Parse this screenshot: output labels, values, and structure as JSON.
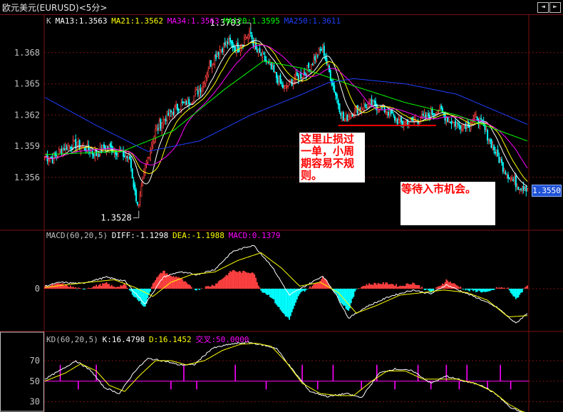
{
  "window": {
    "title": "欧元美元(EURUSD)<5分>",
    "nav_prev_icon": "arrow-left-icon",
    "nav_next_icon": "arrow-right-icon"
  },
  "colors": {
    "grid": "#7a1010",
    "up": "#ff4040",
    "down": "#00ffff",
    "ma13": "#ffffff",
    "ma21": "#ffff00",
    "ma34": "#ff00ff",
    "ma120": "#00ff00",
    "ma250": "#1f3fff",
    "note_text": "#ff0000",
    "support_line": "#ff0000"
  },
  "main_panel": {
    "legend": [
      {
        "key": "k",
        "text": "K",
        "color": "#c0c0c0"
      },
      {
        "key": "ma13",
        "text": "MA13:1.3563",
        "color": "#ffffff"
      },
      {
        "key": "ma21",
        "text": "MA21:1.3562",
        "color": "#ffff00"
      },
      {
        "key": "ma34",
        "text": "MA34:1.3563",
        "color": "#ff00ff"
      },
      {
        "key": "ma120",
        "text": "MA120:1.3595",
        "color": "#00ff00"
      },
      {
        "key": "ma250",
        "text": "MA250:1.3611",
        "color": "#1f3fff"
      }
    ],
    "high_label": "1.3703",
    "low_label": "1.3528",
    "current_price": "1.3550",
    "note1": "这里止损过一单，小周期容易不规则。",
    "note2": "等待入市机会。"
  },
  "macd_panel": {
    "legend": [
      {
        "key": "macd",
        "text": "MACD(60,20,5)",
        "color": "#c0c0c0"
      },
      {
        "key": "diff",
        "text": "DIFF:-1.1298",
        "color": "#ffffff"
      },
      {
        "key": "dea",
        "text": "DEA:-1.1988",
        "color": "#ffff00"
      },
      {
        "key": "macdv",
        "text": "MACD:0.1379",
        "color": "#ff00ff"
      }
    ]
  },
  "kd_panel": {
    "legend": [
      {
        "key": "kd",
        "text": "KD(60,20,5)",
        "color": "#c0c0c0"
      },
      {
        "key": "k",
        "text": "K:16.4798",
        "color": "#ffffff"
      },
      {
        "key": "d",
        "text": "D:16.1452",
        "color": "#ffff00"
      },
      {
        "key": "cross",
        "text": "交叉:50.0000",
        "color": "#ff00ff"
      }
    ]
  },
  "chart_data": [
    {
      "type": "candlestick",
      "title": "",
      "y_ticks": [
        1.356,
        1.359,
        1.362,
        1.365,
        1.368
      ],
      "ylim": [
        1.3525,
        1.371
      ],
      "close_keypoints": [
        [
          0,
          1.358
        ],
        [
          6,
          1.3578
        ],
        [
          14,
          1.3588
        ],
        [
          22,
          1.3592
        ],
        [
          32,
          1.3588
        ],
        [
          40,
          1.3582
        ],
        [
          48,
          1.359
        ],
        [
          58,
          1.3584
        ],
        [
          66,
          1.3578
        ],
        [
          70,
          1.3545
        ],
        [
          73,
          1.3532
        ],
        [
          78,
          1.357
        ],
        [
          86,
          1.3605
        ],
        [
          94,
          1.3618
        ],
        [
          104,
          1.3628
        ],
        [
          114,
          1.3635
        ],
        [
          122,
          1.3648
        ],
        [
          128,
          1.3668
        ],
        [
          134,
          1.368
        ],
        [
          142,
          1.369
        ],
        [
          150,
          1.3684
        ],
        [
          156,
          1.3695
        ],
        [
          160,
          1.3698
        ],
        [
          164,
          1.3682
        ],
        [
          170,
          1.3675
        ],
        [
          178,
          1.366
        ],
        [
          186,
          1.3645
        ],
        [
          194,
          1.3655
        ],
        [
          202,
          1.366
        ],
        [
          210,
          1.3675
        ],
        [
          216,
          1.3685
        ],
        [
          220,
          1.3665
        ],
        [
          226,
          1.364
        ],
        [
          232,
          1.3615
        ],
        [
          238,
          1.3622
        ],
        [
          246,
          1.3628
        ],
        [
          256,
          1.363
        ],
        [
          266,
          1.3624
        ],
        [
          276,
          1.3612
        ],
        [
          286,
          1.3614
        ],
        [
          296,
          1.3618
        ],
        [
          306,
          1.3626
        ],
        [
          314,
          1.3615
        ],
        [
          322,
          1.361
        ],
        [
          330,
          1.3612
        ],
        [
          336,
          1.3618
        ],
        [
          342,
          1.3605
        ],
        [
          350,
          1.3585
        ],
        [
          356,
          1.357
        ],
        [
          362,
          1.356
        ],
        [
          368,
          1.3552
        ],
        [
          375,
          1.355
        ]
      ],
      "ma120_keypoints": [
        [
          0,
          1.3582
        ],
        [
          60,
          1.3585
        ],
        [
          100,
          1.3605
        ],
        [
          140,
          1.3645
        ],
        [
          170,
          1.3672
        ],
        [
          200,
          1.3665
        ],
        [
          240,
          1.3648
        ],
        [
          280,
          1.3632
        ],
        [
          320,
          1.362
        ],
        [
          375,
          1.3595
        ]
      ],
      "ma250_keypoints": [
        [
          0,
          1.3637
        ],
        [
          40,
          1.361
        ],
        [
          80,
          1.3585
        ],
        [
          120,
          1.3595
        ],
        [
          160,
          1.362
        ],
        [
          200,
          1.364
        ],
        [
          220,
          1.3651
        ],
        [
          240,
          1.3655
        ],
        [
          280,
          1.365
        ],
        [
          320,
          1.364
        ],
        [
          375,
          1.3611
        ]
      ],
      "support_line": {
        "from_bar": 228,
        "to_bar": 304,
        "price": 1.361
      }
    },
    {
      "type": "macd",
      "title": "",
      "y_ticks": [
        0
      ],
      "diff_keypoints": [
        [
          0,
          0.2
        ],
        [
          12,
          0.5
        ],
        [
          28,
          0.4
        ],
        [
          48,
          0.9
        ],
        [
          62,
          0.6
        ],
        [
          78,
          -1.2
        ],
        [
          92,
          0.9
        ],
        [
          104,
          1.3
        ],
        [
          118,
          1.1
        ],
        [
          132,
          1.5
        ],
        [
          146,
          2.9
        ],
        [
          162,
          3.4
        ],
        [
          176,
          1.8
        ],
        [
          190,
          -0.5
        ],
        [
          204,
          0.3
        ],
        [
          216,
          1.0
        ],
        [
          226,
          -0.4
        ],
        [
          236,
          -2.3
        ],
        [
          250,
          -1.4
        ],
        [
          268,
          -0.6
        ],
        [
          286,
          -0.1
        ],
        [
          300,
          -0.4
        ],
        [
          312,
          0.3
        ],
        [
          326,
          -0.3
        ],
        [
          338,
          -0.8
        ],
        [
          352,
          -1.5
        ],
        [
          366,
          -2.7
        ],
        [
          375,
          -1.9
        ]
      ],
      "dea_keypoints": [
        [
          0,
          0.1
        ],
        [
          16,
          0.3
        ],
        [
          34,
          0.5
        ],
        [
          54,
          0.7
        ],
        [
          70,
          0.1
        ],
        [
          84,
          -0.6
        ],
        [
          98,
          0.5
        ],
        [
          114,
          1.1
        ],
        [
          132,
          1.3
        ],
        [
          150,
          2.2
        ],
        [
          168,
          2.8
        ],
        [
          184,
          1.6
        ],
        [
          198,
          0.2
        ],
        [
          214,
          0.5
        ],
        [
          228,
          -0.3
        ],
        [
          242,
          -1.9
        ],
        [
          258,
          -1.3
        ],
        [
          276,
          -0.5
        ],
        [
          294,
          -0.3
        ],
        [
          310,
          -0.1
        ],
        [
          328,
          -0.3
        ],
        [
          344,
          -0.9
        ],
        [
          360,
          -2.2
        ],
        [
          375,
          -2.1
        ]
      ]
    },
    {
      "type": "kd",
      "title": "",
      "y_ticks": [
        30,
        50,
        70
      ],
      "ylim": [
        20,
        95
      ],
      "cross_level": 50,
      "k_keypoints": [
        [
          0,
          52
        ],
        [
          14,
          62
        ],
        [
          24,
          70
        ],
        [
          36,
          60
        ],
        [
          46,
          44
        ],
        [
          58,
          38
        ],
        [
          70,
          60
        ],
        [
          80,
          72
        ],
        [
          92,
          70
        ],
        [
          104,
          66
        ],
        [
          116,
          66
        ],
        [
          130,
          82
        ],
        [
          144,
          86
        ],
        [
          158,
          88
        ],
        [
          170,
          85
        ],
        [
          180,
          82
        ],
        [
          192,
          62
        ],
        [
          206,
          40
        ],
        [
          220,
          35
        ],
        [
          234,
          38
        ],
        [
          246,
          34
        ],
        [
          260,
          58
        ],
        [
          272,
          62
        ],
        [
          286,
          60
        ],
        [
          300,
          48
        ],
        [
          312,
          55
        ],
        [
          326,
          50
        ],
        [
          340,
          46
        ],
        [
          352,
          36
        ],
        [
          362,
          24
        ],
        [
          370,
          20
        ],
        [
          375,
          18
        ]
      ],
      "d_keypoints": [
        [
          0,
          50
        ],
        [
          16,
          58
        ],
        [
          28,
          67
        ],
        [
          40,
          60
        ],
        [
          50,
          46
        ],
        [
          62,
          40
        ],
        [
          74,
          56
        ],
        [
          86,
          70
        ],
        [
          98,
          70
        ],
        [
          110,
          66
        ],
        [
          124,
          70
        ],
        [
          138,
          80
        ],
        [
          152,
          86
        ],
        [
          164,
          87
        ],
        [
          176,
          84
        ],
        [
          188,
          68
        ],
        [
          200,
          48
        ],
        [
          214,
          38
        ],
        [
          228,
          36
        ],
        [
          240,
          36
        ],
        [
          254,
          50
        ],
        [
          266,
          60
        ],
        [
          280,
          60
        ],
        [
          294,
          52
        ],
        [
          306,
          52
        ],
        [
          320,
          52
        ],
        [
          334,
          48
        ],
        [
          348,
          40
        ],
        [
          360,
          28
        ],
        [
          370,
          21
        ],
        [
          375,
          19
        ]
      ]
    }
  ]
}
